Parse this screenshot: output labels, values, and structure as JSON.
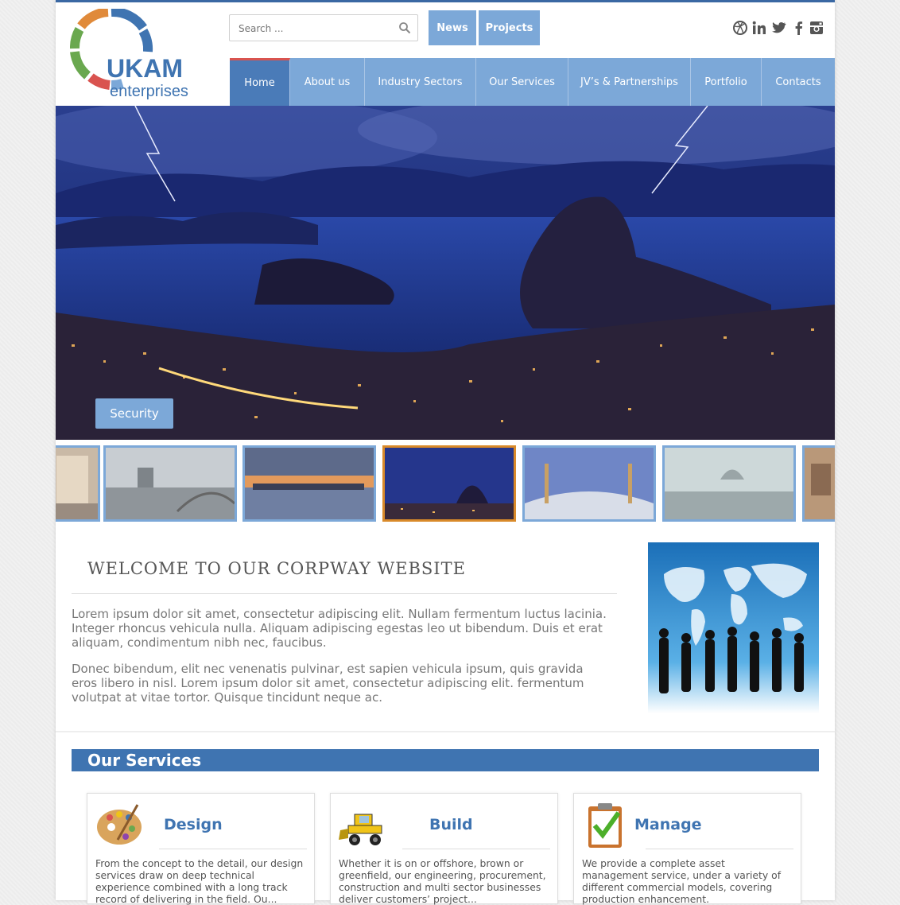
{
  "brand": {
    "name": "UKAM",
    "tagline": "enterprises",
    "colors": {
      "accent": "#7ca8d8",
      "accent_dark": "#3f74b1",
      "active_border": "#d9534f"
    }
  },
  "search": {
    "placeholder": "Search ...",
    "value": ""
  },
  "top_buttons": {
    "news": "News",
    "projects": "Projects"
  },
  "social_icons": [
    "dribbble-icon",
    "linkedin-icon",
    "twitter-icon",
    "facebook-icon",
    "instagram-icon"
  ],
  "nav": {
    "items": [
      {
        "label": "Home",
        "active": true
      },
      {
        "label": "About us"
      },
      {
        "label": "Industry Sectors"
      },
      {
        "label": "Our Services"
      },
      {
        "label": "JV’s & Partnerships"
      },
      {
        "label": "Portfolio"
      },
      {
        "label": "Contacts"
      }
    ]
  },
  "hero": {
    "caption": "Security"
  },
  "welcome": {
    "title": "WELCOME TO OUR CORPWAY WEBSITE",
    "paragraph1": "Lorem ipsum dolor sit amet, consectetur adipiscing elit. Nullam fermentum luctus lacinia. Integer rhoncus vehicula nulla. Aliquam adipiscing egestas leo ut bibendum. Duis et erat aliquam, condimentum nibh nec, faucibus.",
    "paragraph2": "Donec bibendum, elit nec venenatis pulvinar, est sapien vehicula ipsum, quis gravida eros libero in nisl. Lorem ipsum dolor sit amet, consectetur adipiscing elit. fermentum volutpat at vitae tortor. Quisque tincidunt neque ac."
  },
  "services": {
    "heading": "Our Services",
    "cards": [
      {
        "title": "Design",
        "icon": "palette-icon",
        "text": "From the concept to the detail, our design services draw on deep technical experience combined with a long track record of delivering in the field. Ou..."
      },
      {
        "title": "Build",
        "icon": "bulldozer-icon",
        "text": "Whether it is on or offshore, brown or greenfield, our engineering, procurement, construction and multi sector businesses deliver customers’ project..."
      },
      {
        "title": "Manage",
        "icon": "clipboard-check-icon",
        "text": "We provide a complete asset management service, under a variety of different commercial models, covering production enhancement."
      }
    ]
  }
}
